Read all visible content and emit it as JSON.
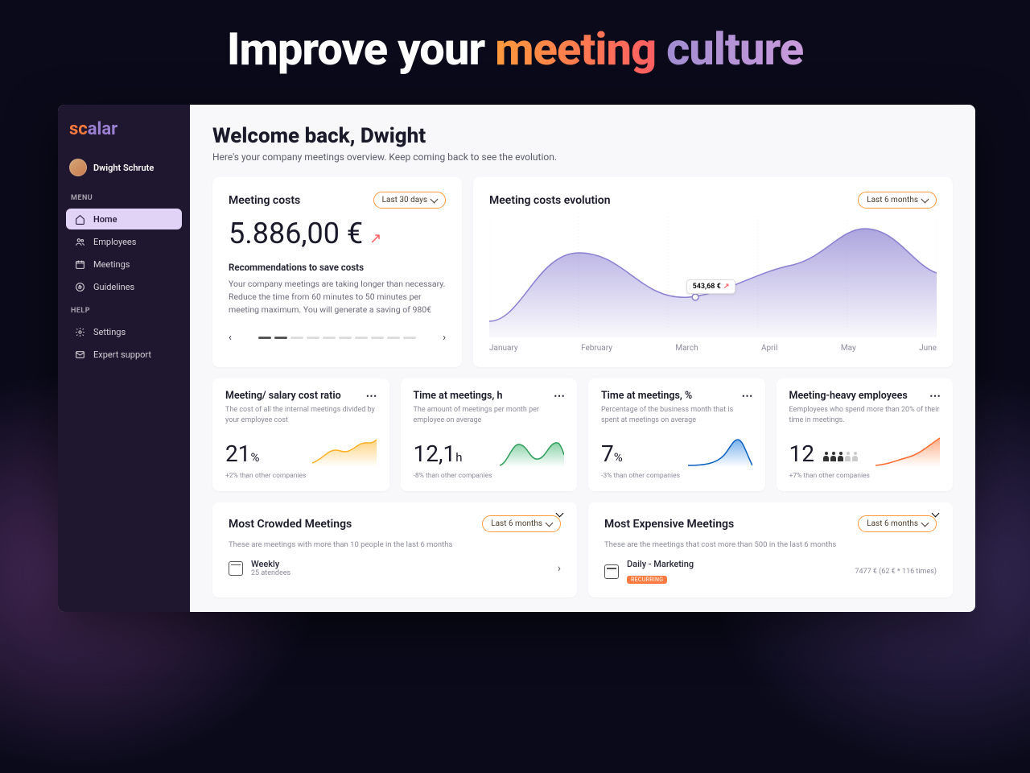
{
  "hero": {
    "prefix": "Improve your ",
    "word1": "meeting",
    "word2": "culture"
  },
  "brand": {
    "part1": "sc",
    "part2": "alar"
  },
  "user": {
    "name": "Dwight Schrute"
  },
  "menu": {
    "section1": "MENU",
    "section2": "HELP",
    "items": {
      "home": "Home",
      "employees": "Employees",
      "meetings": "Meetings",
      "guidelines": "Guidelines",
      "settings": "Settings",
      "support": "Expert support"
    }
  },
  "header": {
    "title": "Welcome back, Dwight",
    "subtitle": "Here's your company meetings overview. Keep coming back to see the evolution."
  },
  "cost_card": {
    "title": "Meeting costs",
    "range_label": "Last 30 days",
    "value": "5.886,00 €",
    "rec_title": "Recommendations to save costs",
    "rec_body": "Your company meetings are taking longer than necessary. Reduce the time from 60 minutes to 50 minutes per meeting maximum. You will generate a saving of 980€"
  },
  "evolution": {
    "title": "Meeting costs evolution",
    "range_label": "Last 6 months",
    "tooltip": "543,68 €",
    "months": [
      "January",
      "February",
      "March",
      "April",
      "May",
      "June"
    ]
  },
  "kpi": [
    {
      "title": "Meeting/ salary cost ratio",
      "desc": "The cost of all the internal meetings divided by your employee cost",
      "value": "21",
      "unit": "%",
      "delta": "+2% than other companies"
    },
    {
      "title": "Time at meetings, h",
      "desc": "The amount of meetings per month per employee on average",
      "value": "12,1",
      "unit": "h",
      "delta": "-8% than other companies"
    },
    {
      "title": "Time at meetings, %",
      "desc": "Percentage of the business month that is spent at meetings on average",
      "value": "7",
      "unit": "%",
      "delta": "-3% than other companies"
    },
    {
      "title": "Meeting-heavy employees",
      "desc": "Eemployees who spend more than 20% of their time in meetings.",
      "value": "12",
      "unit": "",
      "delta": "+7% than other companies"
    }
  ],
  "crowded": {
    "title": "Most Crowded Meetings",
    "sub": "These are meetings with more than 10 people in the last 6 months",
    "range_label": "Last 6 months",
    "item": {
      "name": "Weekly",
      "meta": "25 atendees"
    }
  },
  "expensive": {
    "title": "Most Expensive Meetings",
    "sub": "These are the meetings that cost more than 500 in the last 6 months",
    "range_label": "Last 6 months",
    "item": {
      "name": "Daily - Marketing",
      "badge": "RECURRING",
      "cost": "7477 € (62 € * 116 times)"
    }
  },
  "chart_data": {
    "type": "line",
    "title": "Meeting costs evolution",
    "xlabel": "",
    "ylabel": "",
    "categories": [
      "January",
      "February",
      "March",
      "April",
      "May",
      "June"
    ],
    "values": [
      420,
      680,
      540,
      590,
      780,
      650
    ],
    "highlight": {
      "month": "March",
      "value": 543.68
    },
    "ylim": [
      0,
      900
    ]
  }
}
